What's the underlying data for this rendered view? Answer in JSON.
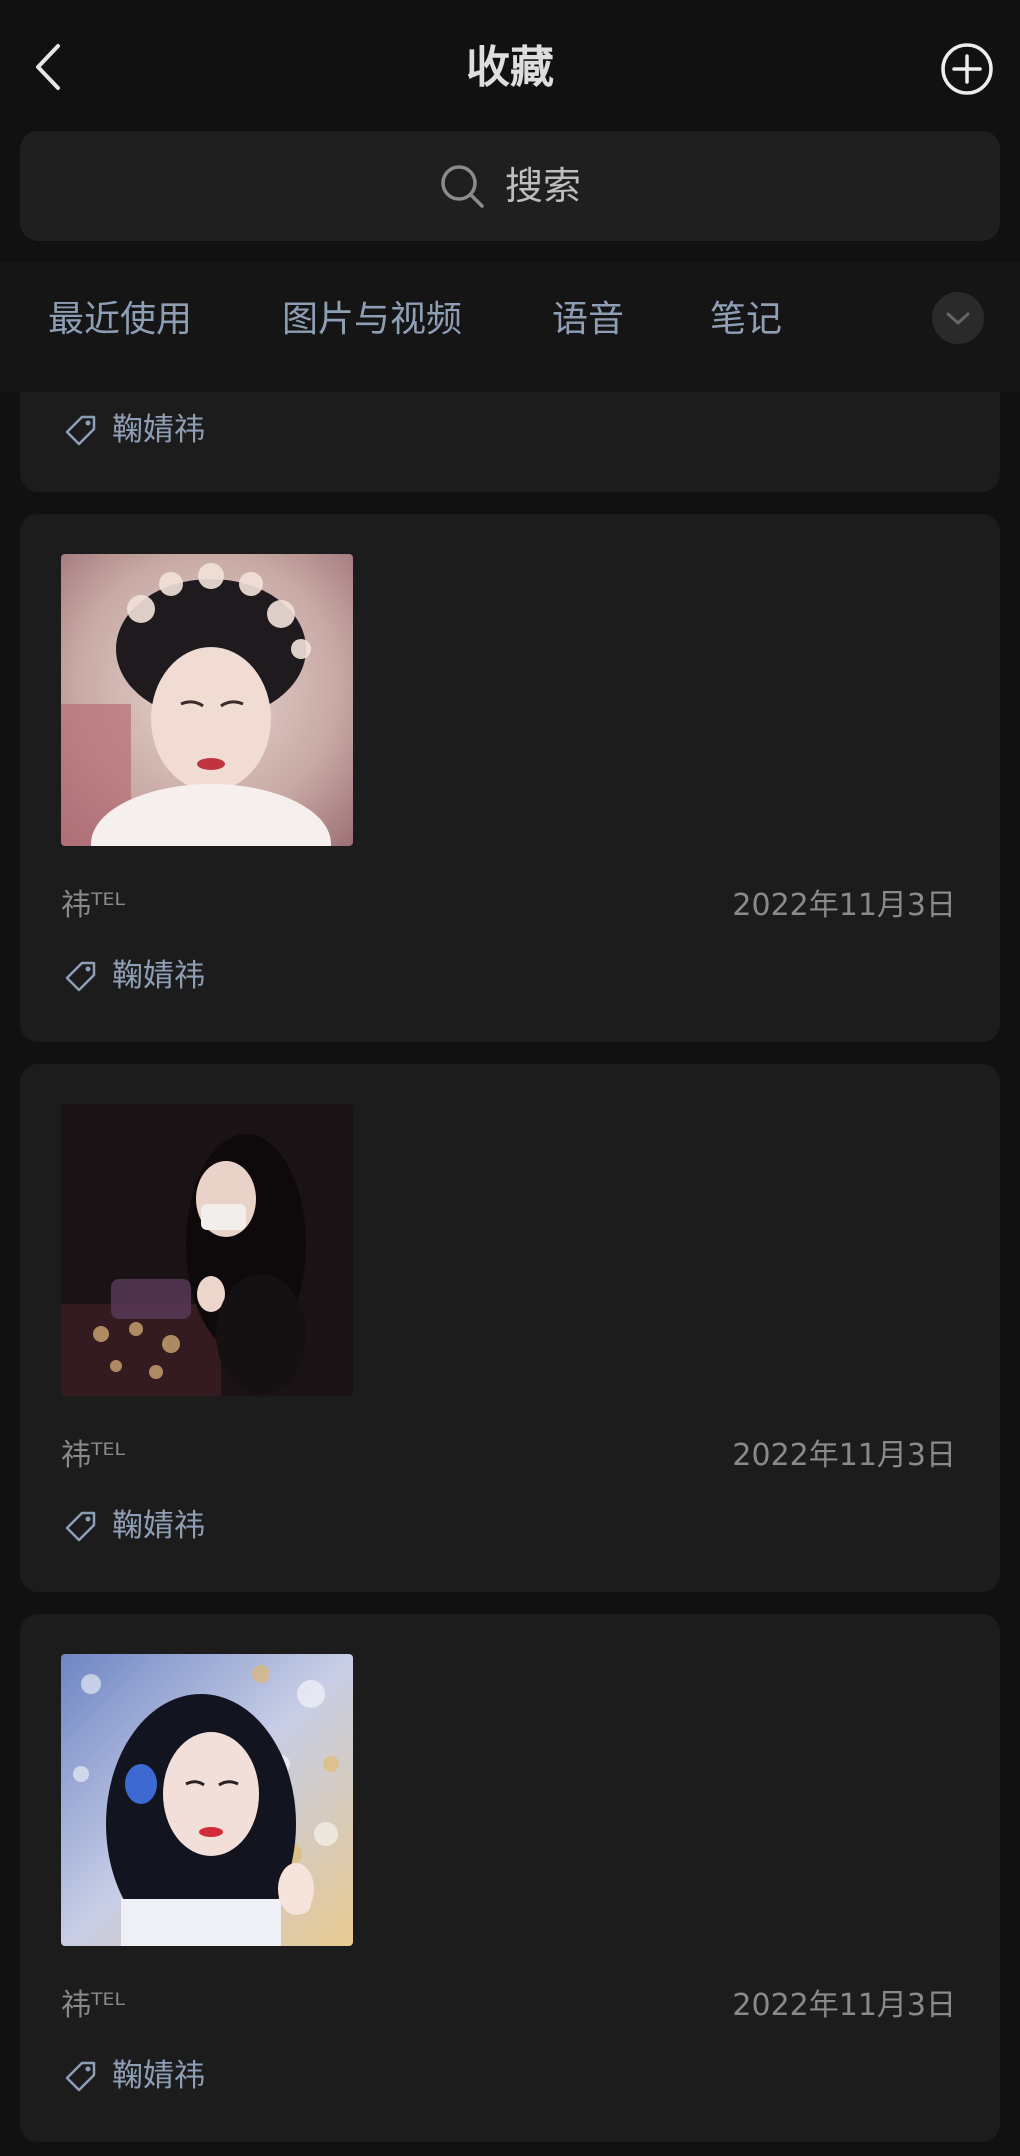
{
  "header": {
    "title": "收藏"
  },
  "search": {
    "placeholder": "搜索"
  },
  "tabs": [
    {
      "label": "最近使用"
    },
    {
      "label": "图片与视频"
    },
    {
      "label": "语音"
    },
    {
      "label": "笔记"
    }
  ],
  "partial_card": {
    "tag": "鞠婧祎"
  },
  "items": [
    {
      "source": "祎ᵀᴱᴸ",
      "date": "2022年11月3日",
      "tag": "鞠婧祎",
      "image": "photo-woman-floral-headdress"
    },
    {
      "source": "祎ᵀᴱᴸ",
      "date": "2022年11月3日",
      "tag": "鞠婧祎",
      "image": "photo-woman-night-lights"
    },
    {
      "source": "祎ᵀᴱᴸ",
      "date": "2022年11月3日",
      "tag": "鞠婧祎",
      "image": "photo-woman-bokeh-sparkles"
    }
  ],
  "icons": {
    "back": "back-chevron-icon",
    "add": "plus-circle-icon",
    "search": "search-icon",
    "expand": "chevron-down-icon",
    "tag": "tag-icon"
  },
  "colors": {
    "background": "#111111",
    "card": "#1c1c1c",
    "accent_text": "#8e9fb5",
    "muted_text": "#8a8a8a"
  }
}
